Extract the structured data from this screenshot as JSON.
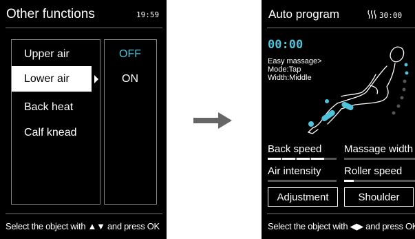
{
  "left_screen": {
    "title": "Other functions",
    "clock": "19:59",
    "menu_items": [
      "Upper air",
      "Lower air",
      "Back heat",
      "Calf knead"
    ],
    "options": [
      "OFF",
      "ON"
    ],
    "footer": "Select the object with ▲▼ and press OK",
    "colors": {
      "accent": "#4fc3d9",
      "selected_bg": "#ffffff"
    }
  },
  "arrow": {
    "icon": "right-arrow-icon",
    "color": "#666666"
  },
  "right_screen": {
    "title": "Auto program",
    "heat_icon": "heat-waves-icon",
    "clock": "30:00",
    "timer": "00:00",
    "info": [
      "Easy massage>",
      "Mode:Tap",
      "Width:Middle"
    ],
    "params": [
      "Back speed",
      "Massage width",
      "Air intensity",
      "Roller speed"
    ],
    "buttons": {
      "adjustment": "Adjustment",
      "shoulder": "Shoulder"
    },
    "footer": "Select the object with ◀▶ and press OK",
    "figure_icon": "massage-chair-figure-icon",
    "colors": {
      "accent": "#4fc3d9"
    }
  }
}
